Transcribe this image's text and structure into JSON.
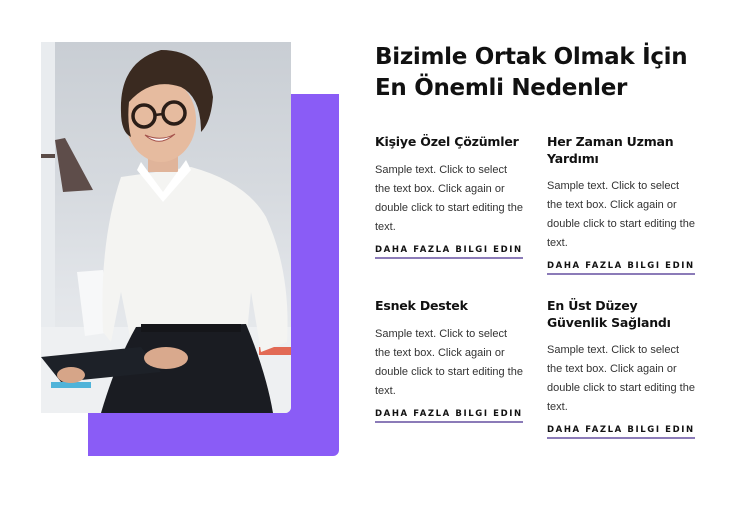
{
  "section": {
    "heading": "Bizimle Ortak Olmak İçin En Önemli Nedenler",
    "accent_color": "#8a5cf6",
    "link_underline_color": "#8b7bb8",
    "image": {
      "alt": "Smiling woman with glasses in white shirt holding a clipboard in an office"
    },
    "features": [
      {
        "title": "Kişiye Özel Çözümler",
        "text": "Sample text. Click to select the text box. Click again or double click to start editing the text.",
        "link": "DAHA FAZLA BILGI EDIN"
      },
      {
        "title": "Her Zaman Uzman Yardımı",
        "text": "Sample text. Click to select the text box. Click again or double click to start editing the text.",
        "link": "DAHA FAZLA BILGI EDIN"
      },
      {
        "title": "Esnek Destek",
        "text": "Sample text. Click to select the text box. Click again or double click to start editing the text.",
        "link": "DAHA FAZLA BILGI EDIN"
      },
      {
        "title": "En Üst Düzey Güvenlik Sağlandı",
        "text": "Sample text. Click to select the text box. Click again or double click to start editing the text.",
        "link": "DAHA FAZLA BILGI EDIN"
      }
    ]
  }
}
